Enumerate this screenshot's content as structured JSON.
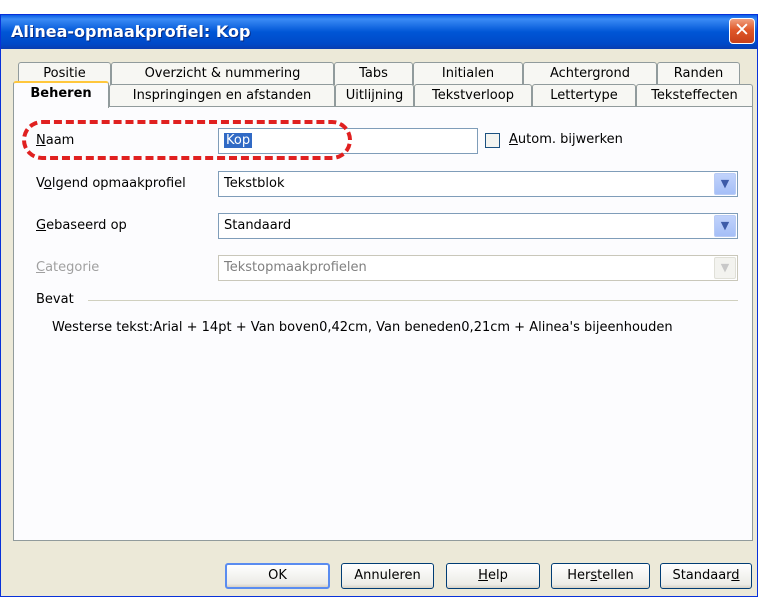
{
  "window": {
    "title": "Alinea-opmaakprofiel: Kop",
    "close_glyph": "✕"
  },
  "tabs_back": [
    {
      "label": "Positie"
    },
    {
      "label": "Overzicht & nummering"
    },
    {
      "label": "Tabs"
    },
    {
      "label": "Initialen"
    },
    {
      "label": "Achtergrond"
    },
    {
      "label": "Randen"
    }
  ],
  "tabs_front": [
    {
      "label": "Beheren",
      "active": true
    },
    {
      "label": "Inspringingen en afstanden"
    },
    {
      "label": "Uitlijning"
    },
    {
      "label": "Tekstverloop"
    },
    {
      "label": "Lettertype"
    },
    {
      "label": "Teksteffecten"
    }
  ],
  "form": {
    "naam": {
      "accel": "N",
      "rest": "aam",
      "value": "Kop"
    },
    "autoupdate": {
      "accel": "A",
      "rest": "utom. bijwerken",
      "checked": false
    },
    "volgend": {
      "pre": "V",
      "accel": "o",
      "rest": "lgend opmaakprofiel",
      "value": "Tekstblok"
    },
    "gebaseerd": {
      "accel": "G",
      "rest": "ebaseerd op",
      "value": "Standaard"
    },
    "categorie": {
      "accel": "C",
      "rest": "ategorie",
      "value": "Tekstopmaakprofielen"
    },
    "dropdown_glyph": "▼"
  },
  "contains": {
    "heading": "Bevat",
    "text": "Westerse tekst:Arial + 14pt + Van boven0,42cm, Van beneden0,21cm + Alinea's bijeenhouden"
  },
  "buttons": {
    "ok": "OK",
    "cancel": "Annuleren",
    "help": {
      "accel": "H",
      "rest": "elp"
    },
    "reset": {
      "pre": "Her",
      "accel": "s",
      "rest": "tellen"
    },
    "standard": {
      "pre": "Standaar",
      "accel": "d",
      "rest": ""
    }
  }
}
